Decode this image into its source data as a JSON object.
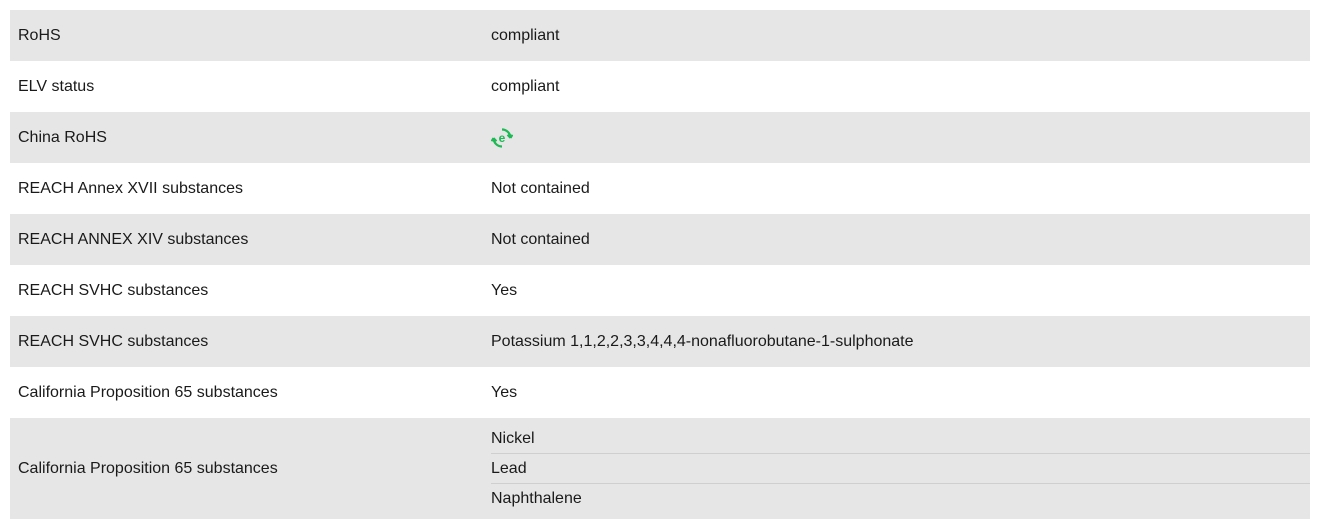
{
  "colors": {
    "stripe": "#e6e6e6",
    "china_rohs_icon": "#1db954"
  },
  "rows": [
    {
      "label": "RoHS",
      "value": "compliant"
    },
    {
      "label": "ELV status",
      "value": "compliant"
    },
    {
      "label": "China RoHS",
      "icon": "china-rohs-green-e-icon"
    },
    {
      "label": "REACH Annex XVII substances",
      "value": "Not contained"
    },
    {
      "label": "REACH ANNEX XIV substances",
      "value": "Not contained"
    },
    {
      "label": "REACH SVHC substances",
      "value": "Yes"
    },
    {
      "label": "REACH SVHC substances",
      "value": "Potassium 1,1,2,2,3,3,4,4,4-nonafluorobutane-1-sulphonate"
    },
    {
      "label": "California Proposition 65 substances",
      "value": "Yes"
    },
    {
      "label": "California Proposition 65 substances",
      "values": [
        "Nickel",
        "Lead",
        "Naphthalene"
      ]
    }
  ]
}
